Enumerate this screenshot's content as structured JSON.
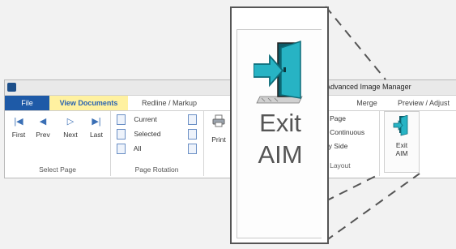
{
  "window": {
    "title": "Advanced Image Manager"
  },
  "tabs": {
    "file": "File",
    "view_documents": "View Documents",
    "redline": "Redline / Markup",
    "merge": "Merge",
    "preview": "Preview / Adjust"
  },
  "select_page": {
    "first": "First",
    "prev": "Prev",
    "next": "Next",
    "last": "Last",
    "group_label": "Select Page"
  },
  "page_rotation": {
    "current": "Current",
    "selected": "Selected",
    "all": "All",
    "group_label": "Page Rotation"
  },
  "print": {
    "label": "Print"
  },
  "page_layout": {
    "item1": "e Page",
    "item2": "e Continuous",
    "item3": "By Side",
    "item4": "e Layout"
  },
  "exit": {
    "label_line1": "Exit",
    "label_line2": "AIM"
  },
  "colors": {
    "file_tab": "#1e5aa7",
    "active_tab_bg": "#fff1a0",
    "accent": "#2a62b0",
    "door": "#27b3c4"
  }
}
